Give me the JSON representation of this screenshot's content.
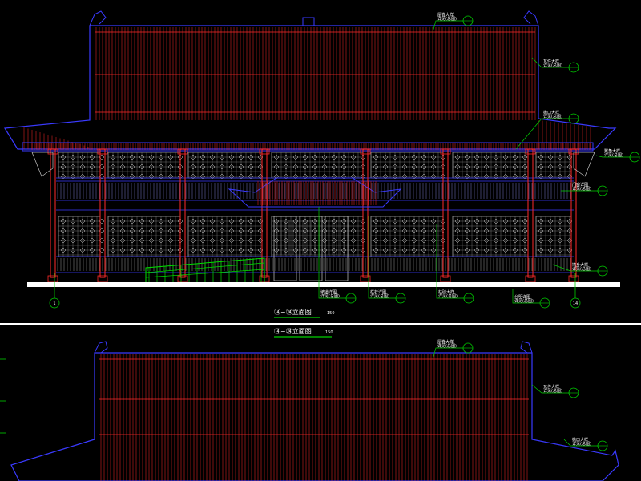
{
  "drawing": {
    "colors": {
      "background": "#000000",
      "roof_outline": "#3a3aff",
      "roof_hatch": "#ff2a2a",
      "column": "#ff2a2a",
      "lattice": "#c8c8c8",
      "leader": "#00d000",
      "ramp": "#00e000",
      "ground": "#ffffff",
      "separator": "#ffffff",
      "text": "#ffffff"
    },
    "views": [
      {
        "title": "⑭~㉔立面图",
        "scale": "150",
        "callouts": [
          {
            "text": "屋脊大样",
            "sub": "详见(总图)"
          },
          {
            "text": "瓦件大样",
            "sub": "详见(总图)"
          },
          {
            "text": "檐口大样",
            "sub": "详见(总图)"
          },
          {
            "text": "翼角大样",
            "sub": "详见(总图)"
          },
          {
            "text": "门窗详图",
            "sub": "详见(总图)"
          },
          {
            "text": "墙身大样",
            "sub": "详见(总图)"
          },
          {
            "text": "台明详图",
            "sub": "详见(总图)"
          },
          {
            "text": "柱础大样",
            "sub": "详见(总图)"
          },
          {
            "text": "栏杆详图",
            "sub": "详见(总图)"
          },
          {
            "text": "坡道详图",
            "sub": "详见(总图)"
          }
        ],
        "axis_left": "1",
        "axis_right": "14"
      },
      {
        "title": "⑭~㉔立面图",
        "scale": "150",
        "callouts": [
          {
            "text": "屋脊大样",
            "sub": "详见(总图)"
          },
          {
            "text": "瓦件大样",
            "sub": "详见(总图)"
          },
          {
            "text": "檐口大样",
            "sub": "详见(总图)"
          }
        ]
      }
    ]
  }
}
